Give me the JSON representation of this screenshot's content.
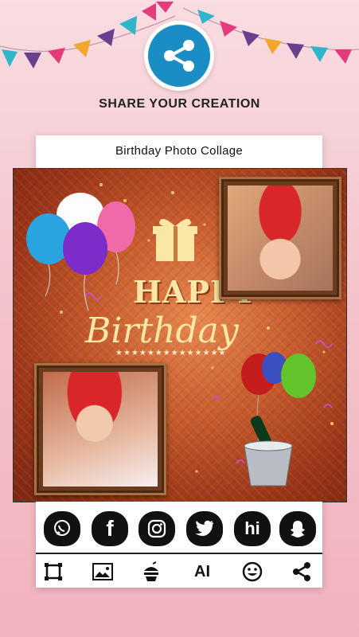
{
  "header": {
    "share_title": "SHARE YOUR CREATION"
  },
  "card": {
    "title": "Birthday Photo Collage"
  },
  "collage": {
    "happy_text": "HAPPY",
    "birthday_text": "Birthday",
    "stars_text": "★★★★★★★★★★★★★★"
  },
  "social_icons": [
    "whatsapp-icon",
    "facebook-icon",
    "instagram-icon",
    "twitter-icon",
    "hike-icon",
    "snapchat-icon"
  ],
  "social_labels": {
    "facebook": "f",
    "hike": "hi"
  },
  "tools": [
    "frame-icon",
    "image-icon",
    "sticker-icon",
    "text-icon",
    "emoji-icon",
    "share-icon"
  ],
  "tool_labels": {
    "text": "AI"
  },
  "colors": {
    "share_blue": "#1a8ec4",
    "background_pink": "#f4c3cc",
    "frame_brown": "#6b3b1e"
  }
}
